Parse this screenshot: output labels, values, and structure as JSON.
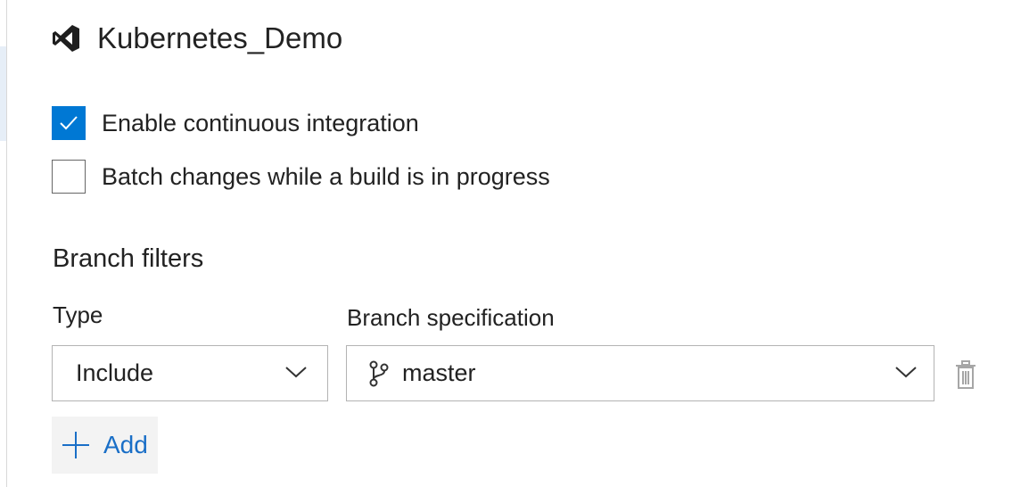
{
  "header": {
    "title": "Kubernetes_Demo",
    "icon": "visual-studio-icon"
  },
  "options": {
    "ci": {
      "label": "Enable continuous integration",
      "checked": true
    },
    "batch": {
      "label": "Batch changes while a build is in progress",
      "checked": false
    }
  },
  "branch_filters": {
    "title": "Branch filters",
    "type_label": "Type",
    "spec_label": "Branch specification",
    "type_value": "Include",
    "spec_value": "master",
    "add_label": "Add"
  },
  "colors": {
    "accent": "#0078d4",
    "link": "#1a6fc7"
  }
}
